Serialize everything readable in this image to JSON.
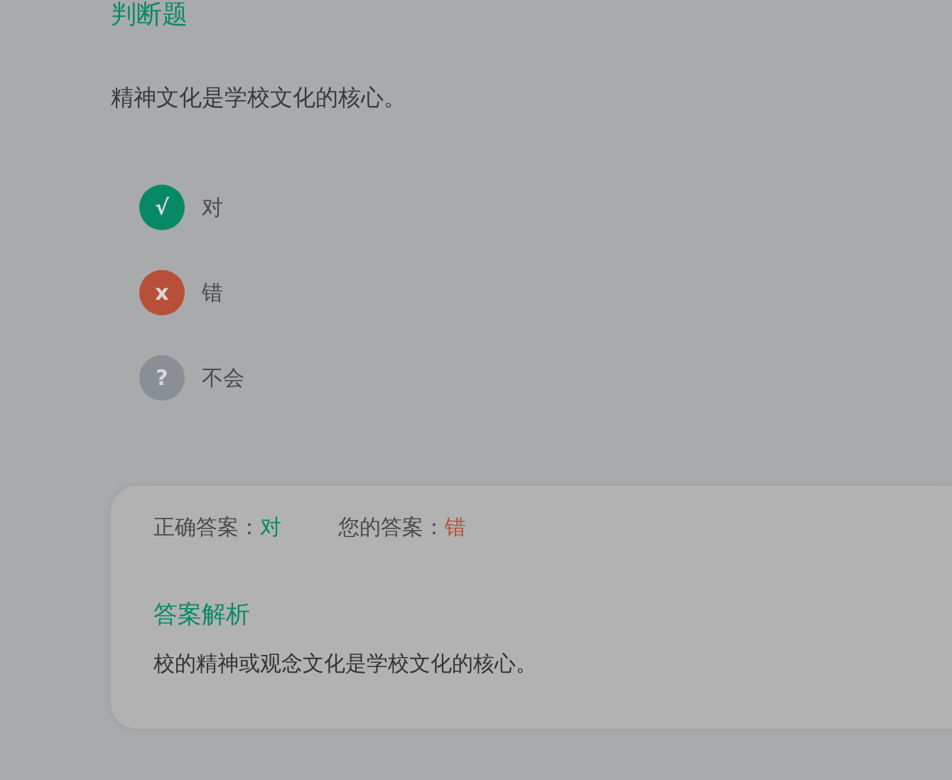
{
  "section_title": "判断题",
  "question": "精神文化是学校文化的核心。",
  "options": [
    {
      "marker": "√",
      "label": "对",
      "color": "#078a64"
    },
    {
      "marker": "x",
      "label": "错",
      "color": "#b85039"
    },
    {
      "marker": "?",
      "label": "不会",
      "color": "#8a8e95"
    }
  ],
  "answers": [
    {
      "label": "正确答案：",
      "value": "对",
      "color": "#078a64"
    },
    {
      "label": "您的答案：",
      "value": "错",
      "color": "#b85039"
    }
  ],
  "analysis": {
    "title": "答案解析",
    "text": "校的精神或观念文化是学校文化的核心。"
  }
}
